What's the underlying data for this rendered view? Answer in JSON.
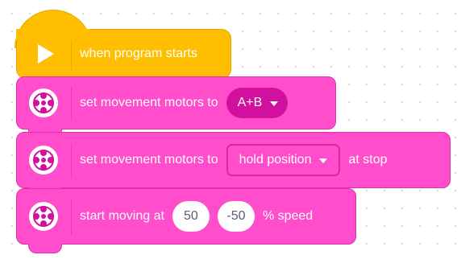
{
  "blocks": {
    "hat": {
      "icon": "play-icon",
      "label": "when program starts",
      "color": "#ffbf00"
    },
    "set_motors": {
      "icon": "motor-icon",
      "text": "set movement motors to",
      "dropdown_value": "A+B",
      "color": "#ff4dcc"
    },
    "set_stop": {
      "icon": "motor-icon",
      "text": "set movement motors to",
      "dropdown_value": "hold position",
      "text_after": "at stop",
      "color": "#ff4dcc"
    },
    "start_moving": {
      "icon": "motor-icon",
      "text": "start moving at",
      "left_value": "50",
      "right_value": "-50",
      "text_after": "% speed",
      "color": "#ff4dcc"
    }
  }
}
